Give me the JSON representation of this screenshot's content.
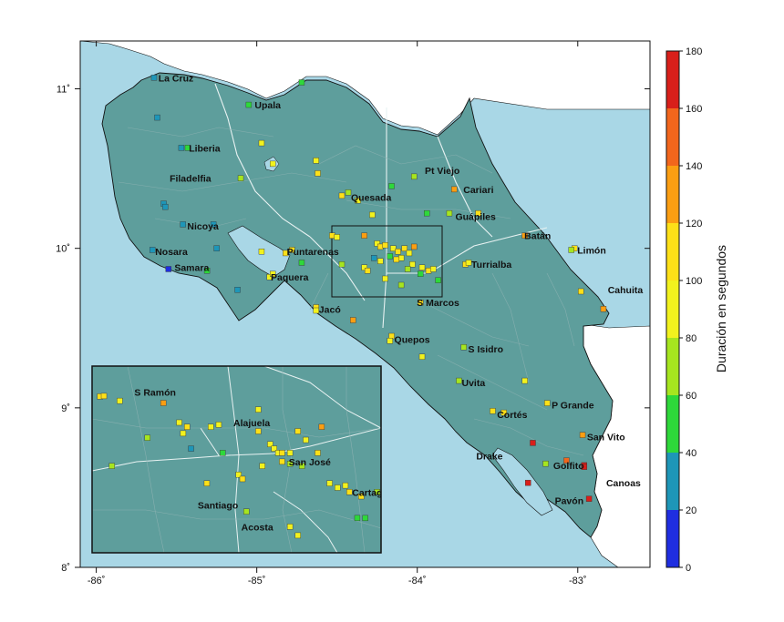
{
  "map": {
    "lon_range": [
      -86.1,
      -82.55
    ],
    "lat_range": [
      8.0,
      11.3
    ],
    "x_ticks": [
      {
        "value": -86,
        "label": "-86˚"
      },
      {
        "value": -85,
        "label": "-85˚"
      },
      {
        "value": -84,
        "label": "-84˚"
      },
      {
        "value": -83,
        "label": "-83˚"
      }
    ],
    "y_ticks": [
      {
        "value": 8,
        "label": "8˚"
      },
      {
        "value": 9,
        "label": "9˚"
      },
      {
        "value": 10,
        "label": "10˚"
      },
      {
        "value": 11,
        "label": "11˚"
      }
    ],
    "colors": {
      "sea": "#a9d7e6",
      "land": "#5e9e9c",
      "foreign": "#ffffff",
      "frame": "#111111"
    },
    "cities": [
      {
        "name": "La Cruz",
        "lon": -85.63,
        "lat": 11.07
      },
      {
        "name": "Upala",
        "lon": -85.03,
        "lat": 10.9
      },
      {
        "name": "Liberia",
        "lon": -85.44,
        "lat": 10.63
      },
      {
        "name": "Filadelfia",
        "lon": -85.56,
        "lat": 10.44
      },
      {
        "name": "Pt Viejo",
        "lon": -83.97,
        "lat": 10.49
      },
      {
        "name": "Cariari",
        "lon": -83.73,
        "lat": 10.37
      },
      {
        "name": "Quesada",
        "lon": -84.43,
        "lat": 10.32
      },
      {
        "name": "Nicoya",
        "lon": -85.45,
        "lat": 10.14
      },
      {
        "name": "Guápiles",
        "lon": -83.78,
        "lat": 10.2
      },
      {
        "name": "Batán",
        "lon": -83.35,
        "lat": 10.08
      },
      {
        "name": "Limón",
        "lon": -83.02,
        "lat": 9.99
      },
      {
        "name": "Nosara",
        "lon": -85.65,
        "lat": 9.98
      },
      {
        "name": "Puntarenas",
        "lon": -84.83,
        "lat": 9.98
      },
      {
        "name": "Turrialba",
        "lon": -83.68,
        "lat": 9.9
      },
      {
        "name": "Samara",
        "lon": -85.53,
        "lat": 9.88
      },
      {
        "name": "Paquera",
        "lon": -84.93,
        "lat": 9.82
      },
      {
        "name": "Cahuita",
        "lon": -82.83,
        "lat": 9.74
      },
      {
        "name": "S Marcos",
        "lon": -84.02,
        "lat": 9.66
      },
      {
        "name": "Jacó",
        "lon": -84.63,
        "lat": 9.62
      },
      {
        "name": "Quepos",
        "lon": -84.16,
        "lat": 9.43
      },
      {
        "name": "S Isidro",
        "lon": -83.7,
        "lat": 9.37
      },
      {
        "name": "Uvita",
        "lon": -83.74,
        "lat": 9.16
      },
      {
        "name": "P Grande",
        "lon": -83.18,
        "lat": 9.02
      },
      {
        "name": "Cortés",
        "lon": -83.52,
        "lat": 8.96
      },
      {
        "name": "San Vito",
        "lon": -82.96,
        "lat": 8.82
      },
      {
        "name": "Drake",
        "lon": -83.65,
        "lat": 8.7
      },
      {
        "name": "Golfito",
        "lon": -83.17,
        "lat": 8.64
      },
      {
        "name": "Canoas",
        "lon": -82.84,
        "lat": 8.53
      },
      {
        "name": "Pavón",
        "lon": -83.16,
        "lat": 8.42
      }
    ],
    "stations": [
      {
        "lon": -85.64,
        "lat": 11.07,
        "dur": 25
      },
      {
        "lon": -85.05,
        "lat": 10.9,
        "dur": 55
      },
      {
        "lon": -84.72,
        "lat": 11.04,
        "dur": 55
      },
      {
        "lon": -85.62,
        "lat": 10.82,
        "dur": 30
      },
      {
        "lon": -85.47,
        "lat": 10.63,
        "dur": 30
      },
      {
        "lon": -85.43,
        "lat": 10.63,
        "dur": 45
      },
      {
        "lon": -84.97,
        "lat": 10.66,
        "dur": 95
      },
      {
        "lon": -84.9,
        "lat": 10.53,
        "dur": 95
      },
      {
        "lon": -84.63,
        "lat": 10.55,
        "dur": 95
      },
      {
        "lon": -84.62,
        "lat": 10.47,
        "dur": 100
      },
      {
        "lon": -85.1,
        "lat": 10.44,
        "dur": 75
      },
      {
        "lon": -84.43,
        "lat": 10.35,
        "dur": 70
      },
      {
        "lon": -84.37,
        "lat": 10.3,
        "dur": 90
      },
      {
        "lon": -84.47,
        "lat": 10.33,
        "dur": 100
      },
      {
        "lon": -84.16,
        "lat": 10.39,
        "dur": 55
      },
      {
        "lon": -84.02,
        "lat": 10.45,
        "dur": 75
      },
      {
        "lon": -83.77,
        "lat": 10.37,
        "dur": 130
      },
      {
        "lon": -84.28,
        "lat": 10.21,
        "dur": 90
      },
      {
        "lon": -83.94,
        "lat": 10.22,
        "dur": 55
      },
      {
        "lon": -83.8,
        "lat": 10.22,
        "dur": 65
      },
      {
        "lon": -83.62,
        "lat": 10.22,
        "dur": 100
      },
      {
        "lon": -85.58,
        "lat": 10.28,
        "dur": 30
      },
      {
        "lon": -85.57,
        "lat": 10.26,
        "dur": 30
      },
      {
        "lon": -85.46,
        "lat": 10.15,
        "dur": 25
      },
      {
        "lon": -85.27,
        "lat": 10.15,
        "dur": 25
      },
      {
        "lon": -85.25,
        "lat": 10.0,
        "dur": 30
      },
      {
        "lon": -85.65,
        "lat": 9.99,
        "dur": 30
      },
      {
        "lon": -85.55,
        "lat": 9.87,
        "dur": 5
      },
      {
        "lon": -85.31,
        "lat": 9.86,
        "dur": 45
      },
      {
        "lon": -85.12,
        "lat": 9.74,
        "dur": 30
      },
      {
        "lon": -84.97,
        "lat": 9.98,
        "dur": 85
      },
      {
        "lon": -84.82,
        "lat": 9.97,
        "dur": 100
      },
      {
        "lon": -84.78,
        "lat": 9.99,
        "dur": 100
      },
      {
        "lon": -84.72,
        "lat": 9.91,
        "dur": 50
      },
      {
        "lon": -84.92,
        "lat": 9.82,
        "dur": 80
      },
      {
        "lon": -84.9,
        "lat": 9.84,
        "dur": 85
      },
      {
        "lon": -84.63,
        "lat": 9.63,
        "dur": 100
      },
      {
        "lon": -84.63,
        "lat": 9.61,
        "dur": 95
      },
      {
        "lon": -84.4,
        "lat": 9.55,
        "dur": 130
      },
      {
        "lon": -84.16,
        "lat": 9.45,
        "dur": 100
      },
      {
        "lon": -84.17,
        "lat": 9.42,
        "dur": 95
      },
      {
        "lon": -83.98,
        "lat": 9.66,
        "dur": 100
      },
      {
        "lon": -83.71,
        "lat": 9.38,
        "dur": 65
      },
      {
        "lon": -83.97,
        "lat": 9.32,
        "dur": 95
      },
      {
        "lon": -83.74,
        "lat": 9.17,
        "dur": 60
      },
      {
        "lon": -83.33,
        "lat": 9.17,
        "dur": 95
      },
      {
        "lon": -83.19,
        "lat": 9.03,
        "dur": 105
      },
      {
        "lon": -83.53,
        "lat": 8.98,
        "dur": 100
      },
      {
        "lon": -83.46,
        "lat": 8.97,
        "dur": 110
      },
      {
        "lon": -83.28,
        "lat": 8.78,
        "dur": 160
      },
      {
        "lon": -82.97,
        "lat": 8.83,
        "dur": 135
      },
      {
        "lon": -83.07,
        "lat": 8.67,
        "dur": 140
      },
      {
        "lon": -83.2,
        "lat": 8.65,
        "dur": 75
      },
      {
        "lon": -82.96,
        "lat": 8.64,
        "dur": 160
      },
      {
        "lon": -82.96,
        "lat": 8.63,
        "dur": 165
      },
      {
        "lon": -83.31,
        "lat": 8.53,
        "dur": 175
      },
      {
        "lon": -82.93,
        "lat": 8.43,
        "dur": 170
      },
      {
        "lon": -83.33,
        "lat": 10.08,
        "dur": 130
      },
      {
        "lon": -83.02,
        "lat": 10.0,
        "dur": 100
      },
      {
        "lon": -83.04,
        "lat": 9.99,
        "dur": 65
      },
      {
        "lon": -82.98,
        "lat": 9.73,
        "dur": 100
      },
      {
        "lon": -82.84,
        "lat": 9.62,
        "dur": 130
      },
      {
        "lon": -83.7,
        "lat": 9.9,
        "dur": 100
      },
      {
        "lon": -83.68,
        "lat": 9.91,
        "dur": 85
      },
      {
        "lon": -84.53,
        "lat": 10.08,
        "dur": 100
      },
      {
        "lon": -84.5,
        "lat": 10.07,
        "dur": 90
      },
      {
        "lon": -84.33,
        "lat": 10.08,
        "dur": 130
      },
      {
        "lon": -84.25,
        "lat": 10.03,
        "dur": 90
      },
      {
        "lon": -84.23,
        "lat": 10.01,
        "dur": 100
      },
      {
        "lon": -84.2,
        "lat": 10.02,
        "dur": 105
      },
      {
        "lon": -84.15,
        "lat": 10.0,
        "dur": 80
      },
      {
        "lon": -84.12,
        "lat": 9.98,
        "dur": 110
      },
      {
        "lon": -84.08,
        "lat": 10.0,
        "dur": 105
      },
      {
        "lon": -84.02,
        "lat": 10.01,
        "dur": 130
      },
      {
        "lon": -84.05,
        "lat": 9.97,
        "dur": 95
      },
      {
        "lon": -84.1,
        "lat": 9.94,
        "dur": 90
      },
      {
        "lon": -84.13,
        "lat": 9.93,
        "dur": 100
      },
      {
        "lon": -84.17,
        "lat": 9.95,
        "dur": 55
      },
      {
        "lon": -84.23,
        "lat": 9.92,
        "dur": 80
      },
      {
        "lon": -84.27,
        "lat": 9.94,
        "dur": 25
      },
      {
        "lon": -84.33,
        "lat": 9.88,
        "dur": 95
      },
      {
        "lon": -84.31,
        "lat": 9.86,
        "dur": 100
      },
      {
        "lon": -84.47,
        "lat": 9.9,
        "dur": 75
      },
      {
        "lon": -84.03,
        "lat": 9.9,
        "dur": 95
      },
      {
        "lon": -83.97,
        "lat": 9.88,
        "dur": 95
      },
      {
        "lon": -83.93,
        "lat": 9.86,
        "dur": 100
      },
      {
        "lon": -83.9,
        "lat": 9.87,
        "dur": 90
      },
      {
        "lon": -83.98,
        "lat": 9.84,
        "dur": 50
      },
      {
        "lon": -84.06,
        "lat": 9.87,
        "dur": 75
      },
      {
        "lon": -84.2,
        "lat": 9.81,
        "dur": 90
      },
      {
        "lon": -84.1,
        "lat": 9.77,
        "dur": 75
      },
      {
        "lon": -83.87,
        "lat": 9.8,
        "dur": 55
      }
    ]
  },
  "inset": {
    "lon_range": [
      -84.57,
      -83.84
    ],
    "lat_range": [
      9.72,
      10.15
    ],
    "cities": [
      {
        "name": "S Ramón",
        "lon": -84.47,
        "lat": 10.09
      },
      {
        "name": "Alajuela",
        "lon": -84.22,
        "lat": 10.02
      },
      {
        "name": "San José",
        "lon": -84.08,
        "lat": 9.93
      },
      {
        "name": "Santiago",
        "lon": -84.31,
        "lat": 9.83
      },
      {
        "name": "Cartago",
        "lon": -83.92,
        "lat": 9.86
      },
      {
        "name": "Acosta",
        "lon": -84.2,
        "lat": 9.78
      }
    ],
    "stations": [
      {
        "lon": -84.55,
        "lat": 10.08,
        "dur": 100
      },
      {
        "lon": -84.54,
        "lat": 10.081,
        "dur": 110
      },
      {
        "lon": -84.5,
        "lat": 10.07,
        "dur": 90
      },
      {
        "lon": -84.39,
        "lat": 10.065,
        "dur": 130
      },
      {
        "lon": -84.35,
        "lat": 10.02,
        "dur": 90
      },
      {
        "lon": -84.33,
        "lat": 10.01,
        "dur": 100
      },
      {
        "lon": -84.27,
        "lat": 10.01,
        "dur": 95
      },
      {
        "lon": -84.25,
        "lat": 10.015,
        "dur": 90
      },
      {
        "lon": -84.15,
        "lat": 10.05,
        "dur": 90
      },
      {
        "lon": -84.15,
        "lat": 10.0,
        "dur": 100
      },
      {
        "lon": -84.05,
        "lat": 10.0,
        "dur": 110
      },
      {
        "lon": -83.99,
        "lat": 10.01,
        "dur": 130
      },
      {
        "lon": -84.43,
        "lat": 9.985,
        "dur": 75
      },
      {
        "lon": -84.34,
        "lat": 9.995,
        "dur": 90
      },
      {
        "lon": -84.32,
        "lat": 9.96,
        "dur": 25
      },
      {
        "lon": -84.24,
        "lat": 9.95,
        "dur": 55
      },
      {
        "lon": -84.12,
        "lat": 9.97,
        "dur": 90
      },
      {
        "lon": -84.11,
        "lat": 9.96,
        "dur": 80
      },
      {
        "lon": -84.1,
        "lat": 9.95,
        "dur": 95
      },
      {
        "lon": -84.09,
        "lat": 9.95,
        "dur": 100
      },
      {
        "lon": -84.07,
        "lat": 9.95,
        "dur": 85
      },
      {
        "lon": -84.03,
        "lat": 9.98,
        "dur": 95
      },
      {
        "lon": -84.0,
        "lat": 9.95,
        "dur": 100
      },
      {
        "lon": -84.14,
        "lat": 9.92,
        "dur": 90
      },
      {
        "lon": -84.09,
        "lat": 9.93,
        "dur": 100
      },
      {
        "lon": -84.07,
        "lat": 9.925,
        "dur": 75
      },
      {
        "lon": -84.52,
        "lat": 9.92,
        "dur": 60
      },
      {
        "lon": -84.28,
        "lat": 9.88,
        "dur": 100
      },
      {
        "lon": -84.2,
        "lat": 9.9,
        "dur": 90
      },
      {
        "lon": -84.19,
        "lat": 9.89,
        "dur": 100
      },
      {
        "lon": -84.04,
        "lat": 9.92,
        "dur": 75
      },
      {
        "lon": -83.97,
        "lat": 9.88,
        "dur": 95
      },
      {
        "lon": -83.95,
        "lat": 9.87,
        "dur": 95
      },
      {
        "lon": -83.93,
        "lat": 9.875,
        "dur": 80
      },
      {
        "lon": -83.92,
        "lat": 9.86,
        "dur": 100
      },
      {
        "lon": -83.89,
        "lat": 9.85,
        "dur": 100
      },
      {
        "lon": -83.85,
        "lat": 9.86,
        "dur": 70
      },
      {
        "lon": -84.18,
        "lat": 9.815,
        "dur": 75
      },
      {
        "lon": -84.07,
        "lat": 9.78,
        "dur": 90
      },
      {
        "lon": -84.05,
        "lat": 9.76,
        "dur": 80
      },
      {
        "lon": -83.9,
        "lat": 9.8,
        "dur": 50
      },
      {
        "lon": -83.88,
        "lat": 9.8,
        "dur": 55
      }
    ]
  },
  "colorbar": {
    "label": "Duración en segundos",
    "min": 0,
    "max": 180,
    "ticks": [
      {
        "value": 0,
        "label": "0"
      },
      {
        "value": 20,
        "label": "20"
      },
      {
        "value": 40,
        "label": "40"
      },
      {
        "value": 60,
        "label": "60"
      },
      {
        "value": 80,
        "label": "80"
      },
      {
        "value": 100,
        "label": "100"
      },
      {
        "value": 120,
        "label": "120"
      },
      {
        "value": 140,
        "label": "140"
      },
      {
        "value": 160,
        "label": "160"
      },
      {
        "value": 180,
        "label": "180"
      }
    ],
    "bins": [
      {
        "from": 0,
        "to": 20,
        "color": "#1f2ee0"
      },
      {
        "from": 20,
        "to": 40,
        "color": "#1e96b8"
      },
      {
        "from": 40,
        "to": 60,
        "color": "#2ed83a"
      },
      {
        "from": 60,
        "to": 80,
        "color": "#a6e51f"
      },
      {
        "from": 80,
        "to": 100,
        "color": "#f2f21e"
      },
      {
        "from": 100,
        "to": 120,
        "color": "#fde018"
      },
      {
        "from": 120,
        "to": 140,
        "color": "#fb9e12"
      },
      {
        "from": 140,
        "to": 160,
        "color": "#f2661c"
      },
      {
        "from": 160,
        "to": 180,
        "color": "#d81f1a"
      }
    ]
  }
}
